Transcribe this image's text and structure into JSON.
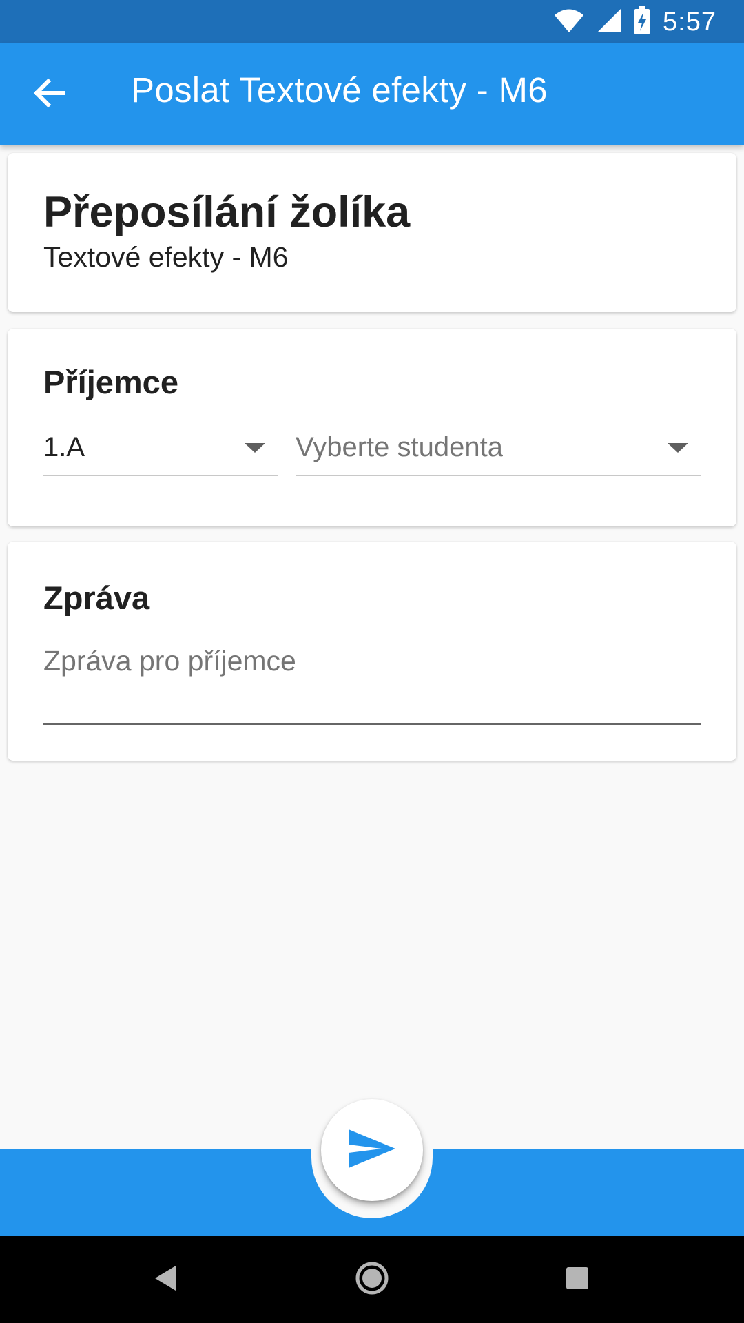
{
  "status_bar": {
    "time": "5:57",
    "icons": [
      "wifi-icon",
      "signal-icon",
      "battery-charging-icon"
    ],
    "background": "#1e6fb8"
  },
  "app_bar": {
    "title": "Poslat Textové efekty - M6",
    "back_icon": "arrow-back-icon",
    "background": "#2394ec"
  },
  "header_card": {
    "title": "Přeposílání žolíka",
    "subtitle": "Textové efekty - M6"
  },
  "recipient_card": {
    "title": "Příjemce",
    "class_dropdown": {
      "value": "1.A"
    },
    "student_dropdown": {
      "placeholder": "Vyberte studenta"
    }
  },
  "message_card": {
    "title": "Zpráva",
    "message_input": {
      "placeholder": "Zpráva pro příjemce",
      "value": ""
    }
  },
  "fab": {
    "icon": "send-icon",
    "color": "#2394ec"
  },
  "nav_bar": {
    "icons": [
      "nav-back-icon",
      "nav-home-icon",
      "nav-recents-icon"
    ]
  },
  "colors": {
    "primary": "#2394ec",
    "status_bar": "#1e6fb8",
    "background": "#f9f9f9",
    "card": "#ffffff"
  }
}
